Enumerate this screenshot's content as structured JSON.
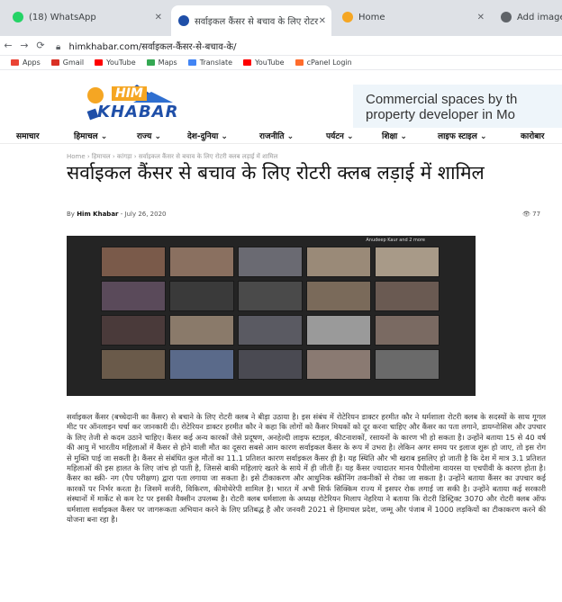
{
  "browser": {
    "tabs": [
      {
        "label": "(18) WhatsApp",
        "favicon_color": "#25d366",
        "active": false
      },
      {
        "label": "सर्वाइकल कैंसर से बचाव के लिए रोटर",
        "favicon_color": "#1f4fa8",
        "active": true
      },
      {
        "label": "Home",
        "favicon_color": "#f5a623",
        "active": false
      },
      {
        "label": "Add image",
        "favicon_color": "#5f6368",
        "active": false
      }
    ],
    "url": "himkhabar.com/सर्वाइकल-कैंसर-से-बचाव-के/",
    "bookmarks": [
      {
        "label": "Apps",
        "color": "#ea4335"
      },
      {
        "label": "Gmail",
        "color": "#d93025"
      },
      {
        "label": "YouTube",
        "color": "#ff0000"
      },
      {
        "label": "Maps",
        "color": "#34a853"
      },
      {
        "label": "Translate",
        "color": "#4285f4"
      },
      {
        "label": "YouTube",
        "color": "#ff0000"
      },
      {
        "label": "cPanel Login",
        "color": "#ff6c2c"
      }
    ]
  },
  "site": {
    "logo_him": "HIM",
    "logo_khabar": "KHABAR",
    "ad_line1": "Commercial spaces by th",
    "ad_line2": "property developer in Mo",
    "menu": [
      "समाचार",
      "हिमाचल ⌄",
      "राज्य ⌄",
      "देश-दुनिया ⌄",
      "राजनीति ⌄",
      "पर्यटन ⌄",
      "शिक्षा ⌄",
      "लाइफ स्टाइल ⌄",
      "कारोबार"
    ]
  },
  "article": {
    "breadcrumb": "Home  ›  हिमाचल  ›  कांगड़ा  ›  सर्वाइकल कैंसर से बचाव के लिए रोटरी क्लब लड़ाई में शामिल",
    "title": "सर्वाइकल कैंसर से बचाव के लिए रोटरी क्लब लड़ाई में शामिल",
    "byline_prefix": "By",
    "author": "Him Khabar",
    "date": "July 26, 2020",
    "views": "77",
    "video_participant_label": "Anudeep Kaur and 2 more",
    "body": "सर्वाइकल कैंसर (बच्चेदानी का कैंसर) से बचाने के लिए रोटरी क्लब ने बीड़ा उठाया है। इस संबंध में रोटेरियन डाक्टर हरमीत कौर ने धर्मशाला रोटरी क्लब के सदस्यों के साथ गूगल मीट पर ऑनलाइन चर्चा कर जानकारी दी। रोटेरियन डाक्टर हरमीत कौर ने कहा कि लोगों को कैंसर मिथकों को दूर करना चाहिए और कैंसर का पता लगाने, डायग्नोसिस और उपचार के लिए तेजी से कदम उठाने चाहिए। कैंसर कई अन्य कारकों जैसे प्रदूषण, अनहेल्दी लाइफ स्टाइल, कीटनाशकों, रसायनों के कारण भी हो सकता है। उन्होंने बताया 15 से 40 वर्ष की आयु में भारतीय महिलाओं में कैंसर से होने वाली मौत का दूसरा सबसे आम कारण सर्वाइकल कैंसर के रूप में उभरा है। लेकिन अगर समय पर इलाज शुरू हो जाए, तो इस रोग से मुक्ति पाई जा सकती है। कैंसर से संबंधित कुल मौतों का 11.1 प्रतिशत कारण सर्वाइकल कैंसर ही है। यह स्थिति और भी खराब इसलिए हो जाती है कि देश में मात्र 3.1 प्रतिशत महिलाओं की इस हालत के लिए जांच हो पाती है, जिससे बाकी महिलाएं खतरे के साये में ही जीती हैं। यह कैंसर ज्यादातर मानव पैपीलोमा वायरस या एचपीवी के कारण होता है। कैंसर का स्क्री- नग (पैप परीक्षण) द्वारा पता लगाया जा सकता है। इसे टीकाकरण और आधुनिक स्क्रीनिंग तकनीकों से रोका जा सकता है। उन्होंने बताया कैंसर का उपचार कई कारकों पर निर्भर करता है। जिसमें सर्जरी, विकिरण, कीमोथेरेपी शामिल है। भारत में अभी सिर्फ सिक्किम राज्य में इसपर रोक लगाई जा सकी है। उन्होंने बताया कई सरकारी संस्थानों में मार्केट से कम रेट पर इसकी वैक्सीन उपलब्ध है। रोटरी क्लब धर्मशाला के अध्यक्ष रोटेरियन मिलाप नेहरिया ने बताया कि रोटरी डिस्ट्रिक्ट 3070 और रोटरी क्लब ऑफ धर्मशाला सर्वाइकल कैंसर पर जागरूकता अभियान करने के लिए प्रतिबद्ध है और जनवरी 2021 से हिमाचल प्रदेश, जम्मू और पंजाब में 1000 लड़कियों का टीकाकरण करने की योजना बना रहा है।"
  }
}
